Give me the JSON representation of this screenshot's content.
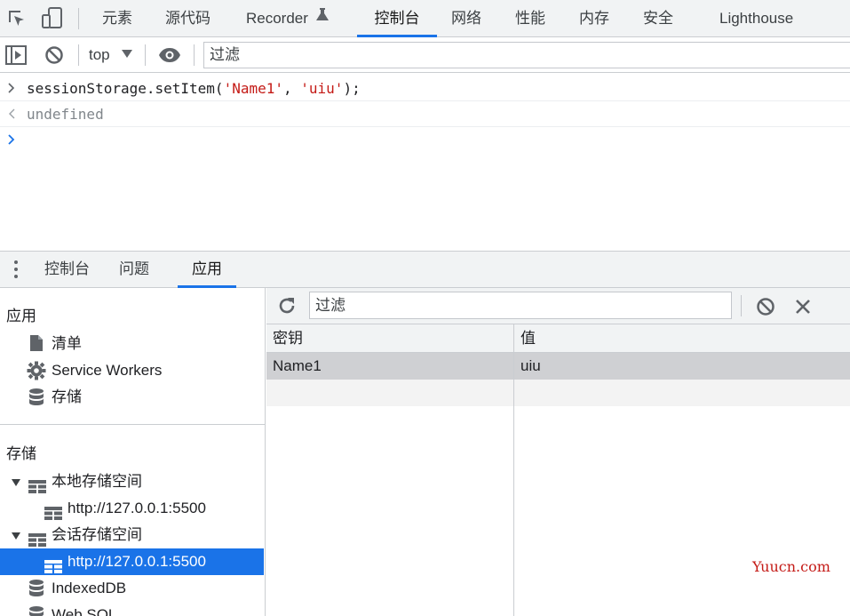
{
  "top_tabs": [
    {
      "label": "元素"
    },
    {
      "label": "源代码"
    },
    {
      "label": "Recorder"
    },
    {
      "label": "控制台"
    },
    {
      "label": "网络"
    },
    {
      "label": "性能"
    },
    {
      "label": "内存"
    },
    {
      "label": "安全"
    },
    {
      "label": "Lighthouse"
    }
  ],
  "active_top_tab": "控制台",
  "console_toolbar": {
    "context": "top",
    "filter_placeholder": "过滤"
  },
  "console": {
    "lines": [
      {
        "prefix": "sessionStorage.setItem(",
        "arg1": "'Name1'",
        "sep": ", ",
        "arg2": "'uiu'",
        "suffix": ");"
      },
      {
        "result": "undefined"
      }
    ]
  },
  "drawer_tabs": [
    {
      "label": "控制台"
    },
    {
      "label": "问题"
    },
    {
      "label": "应用"
    }
  ],
  "active_drawer_tab": "应用",
  "sidebar": {
    "app_section": "应用",
    "app_items": [
      {
        "label": "清单",
        "icon": "document-icon"
      },
      {
        "label": "Service Workers",
        "icon": "gear-icon"
      },
      {
        "label": "存储",
        "icon": "database-icon"
      }
    ],
    "storage_section": "存储",
    "local_storage": {
      "label": "本地存储空间",
      "child": "http://127.0.0.1:5500"
    },
    "session_storage": {
      "label": "会话存储空间",
      "child": "http://127.0.0.1:5500"
    },
    "indexeddb": "IndexedDB",
    "websql": "Web SQL"
  },
  "storage_panel": {
    "filter_placeholder": "过滤",
    "columns": [
      "密钥",
      "值"
    ],
    "rows": [
      {
        "key": "Name1",
        "value": "uiu"
      }
    ]
  },
  "watermark": "Yuucn.com",
  "colors": {
    "accent": "#1a73e8",
    "string": "#c41a16"
  }
}
